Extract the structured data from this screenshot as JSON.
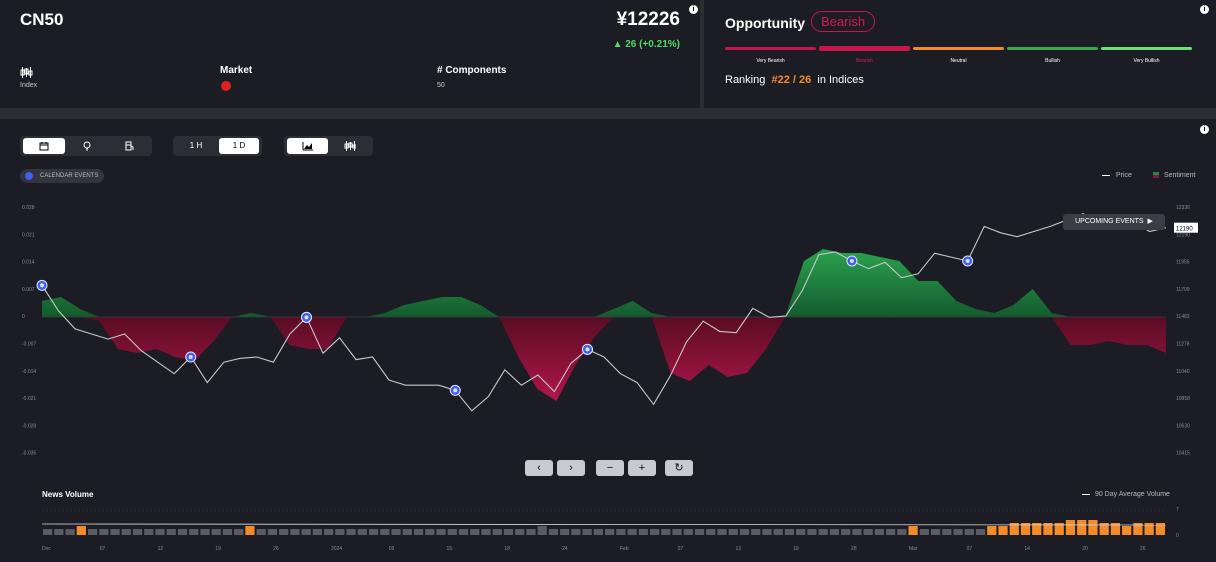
{
  "header": {
    "symbol": "CN50",
    "price": "¥12226",
    "change": "▲ 26 (+0.21%)",
    "type_label": "Index",
    "market_label": "Market",
    "components_label": "# Components",
    "components_value": "50",
    "colors": {
      "positive": "#4cd964"
    }
  },
  "opportunity": {
    "title": "Opportunity",
    "status": "Bearish",
    "scale": [
      {
        "label": "Very Bearish",
        "color": "#c8164b"
      },
      {
        "label": "Bearish",
        "color": "#c8164b"
      },
      {
        "label": "Neutral",
        "color": "#f28b2a"
      },
      {
        "label": "Bullish",
        "color": "#3ba74a"
      },
      {
        "label": "Very Bullish",
        "color": "#6ee07a"
      }
    ],
    "active_index": 1,
    "ranking_prefix": "Ranking",
    "ranking_value": "#22 / 26",
    "ranking_suffix": "in Indices"
  },
  "toolbar": {
    "view_icons": [
      "calendar-icon",
      "bulb-icon",
      "fuel-icon"
    ],
    "intervals": [
      "1 H",
      "1 D"
    ],
    "active_interval": "1 D",
    "chart_modes": [
      "area-chart-icon",
      "candlestick-icon"
    ],
    "calendar_events_label": "CALENDAR EVENTS"
  },
  "legend": {
    "price": "Price",
    "sentiment": "Sentiment",
    "volume": "90 Day Average Volume"
  },
  "upcoming_label": "UPCOMING EVENTS",
  "news_volume_title": "News Volume",
  "chart_data": {
    "type": "line",
    "left_axis_ticks": [
      "0.028",
      "0.021",
      "0.014",
      "0.007",
      "0",
      "-0.007",
      "-0.014",
      "-0.021",
      "-0.028",
      "-0.035"
    ],
    "right_axis_ticks": [
      "12336",
      "12190",
      "11955",
      "11709",
      "11483",
      "11278",
      "11040",
      "10858",
      "10630",
      "10415"
    ],
    "price_label": "12190",
    "x_ticks": [
      "Dec",
      "07",
      "12",
      "19",
      "26",
      "2024",
      "09",
      "15",
      "18",
      "24",
      "Feb",
      "07",
      "13",
      "18",
      "28",
      "Mar",
      "07",
      "14",
      "20",
      "26"
    ],
    "price": [
      11740,
      11540,
      11400,
      11360,
      11320,
      11360,
      11230,
      11140,
      11050,
      11180,
      10980,
      11140,
      11170,
      11180,
      11140,
      11360,
      11490,
      11210,
      11330,
      11160,
      11180,
      11000,
      10960,
      10960,
      10960,
      10920,
      10760,
      10870,
      11080,
      10960,
      11040,
      10910,
      11130,
      11240,
      11180,
      11050,
      10980,
      10810,
      11030,
      11300,
      11460,
      11380,
      11370,
      11560,
      11490,
      11500,
      11700,
      11980,
      12000,
      11930,
      11870,
      11920,
      11800,
      11830,
      11990,
      11960,
      11930,
      12200,
      12150,
      12120,
      12160,
      12200,
      12250,
      12300,
      12190,
      12210,
      12240,
      12160,
      12190
    ],
    "sentiment": [
      0.004,
      0.005,
      0.002,
      -0.001,
      -0.008,
      -0.009,
      -0.008,
      -0.01,
      -0.011,
      -0.006,
      0.0,
      0.001,
      0.0,
      -0.007,
      -0.008,
      -0.008,
      0.0,
      0.0,
      0.001,
      0.003,
      0.004,
      0.005,
      0.005,
      0.003,
      0.0,
      -0.01,
      -0.018,
      -0.021,
      -0.012,
      -0.005,
      0.002,
      0.004,
      0.001,
      -0.014,
      -0.016,
      -0.012,
      -0.015,
      -0.014,
      -0.008,
      0.0,
      0.014,
      0.017,
      0.016,
      0.016,
      0.015,
      0.014,
      0.009,
      0.009,
      0.004,
      0.002,
      0.001,
      0.003,
      0.007,
      0.001,
      -0.007,
      -0.007,
      -0.006,
      -0.007,
      -0.007,
      -0.009
    ],
    "event_markers": [
      0.0,
      0.13,
      0.23,
      0.24,
      0.37,
      0.48,
      0.49,
      0.72,
      0.82
    ],
    "news_volume": [
      2,
      2,
      2,
      3,
      2,
      2,
      2,
      2,
      2,
      2,
      2,
      2,
      2,
      2,
      2,
      2,
      2,
      2,
      3,
      2,
      2,
      2,
      2,
      2,
      2,
      2,
      2,
      2,
      2,
      2,
      2,
      2,
      2,
      2,
      2,
      2,
      2,
      2,
      2,
      2,
      2,
      2,
      2,
      2,
      3,
      2,
      2,
      2,
      2,
      2,
      2,
      2,
      2,
      2,
      2,
      2,
      2,
      2,
      2,
      2,
      2,
      2,
      2,
      2,
      2,
      2,
      2,
      2,
      2,
      2,
      2,
      2,
      2,
      2,
      2,
      2,
      2,
      3,
      2,
      2,
      2,
      2,
      2,
      2,
      3,
      3,
      4,
      4,
      4,
      4,
      4,
      5,
      5,
      5,
      4,
      4,
      3,
      4,
      4,
      4
    ],
    "news_highlight": [
      false,
      false,
      false,
      true,
      false,
      false,
      false,
      false,
      false,
      false,
      false,
      false,
      false,
      false,
      false,
      false,
      false,
      false,
      true,
      false,
      false,
      false,
      false,
      false,
      false,
      false,
      false,
      false,
      false,
      false,
      false,
      false,
      false,
      false,
      false,
      false,
      false,
      false,
      false,
      false,
      false,
      false,
      false,
      false,
      false,
      false,
      false,
      false,
      false,
      false,
      false,
      false,
      false,
      false,
      false,
      false,
      false,
      false,
      false,
      false,
      false,
      false,
      false,
      false,
      false,
      false,
      false,
      false,
      false,
      false,
      false,
      false,
      false,
      false,
      false,
      false,
      false,
      true,
      false,
      false,
      false,
      false,
      false,
      false,
      true,
      true,
      true,
      true,
      true,
      true,
      true,
      true,
      true,
      true,
      true,
      true,
      true,
      true,
      true,
      true
    ],
    "news_axis": [
      "7",
      "0"
    ],
    "colors": {
      "positive": "#1e8a43",
      "negative": "#8e1236",
      "price": "#c8c8c8",
      "marker": "#3f5ff0",
      "volume": "#f28b2a",
      "volume_low": "#5a5b63"
    }
  }
}
